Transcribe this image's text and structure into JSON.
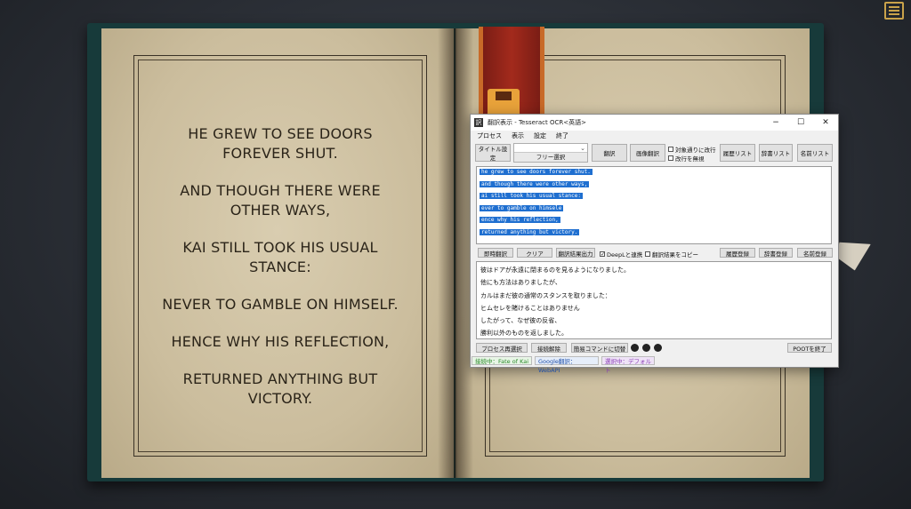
{
  "game": {
    "story_lines": [
      "HE GREW TO SEE DOORS FOREVER SHUT.",
      "AND THOUGH THERE WERE OTHER WAYS,",
      "KAI STILL TOOK HIS USUAL STANCE:",
      "NEVER TO GAMBLE ON HIMSELF.",
      "HENCE WHY HIS REFLECTION,",
      "RETURNED ANYTHING BUT VICTORY."
    ],
    "menu_icon": "menu-icon",
    "bookmark_icon": "save-icon",
    "colors": {
      "cover": "#173a3a",
      "page": "#d9cdb0",
      "ink": "#2b2419",
      "bookmark": "#a32a1c",
      "accent": "#e8a23a"
    }
  },
  "window": {
    "title": "翻訳表示 - Tesseract OCR<英語>",
    "controls": {
      "minimize": "−",
      "maximize": "☐",
      "close": "✕"
    },
    "menu": [
      "プロセス",
      "表示",
      "設定",
      "終了"
    ],
    "toolbar": {
      "title_setting": "タイトル設定",
      "free_select": "フリー選択",
      "translate": "翻訳",
      "image_translate": "画像翻訳",
      "chk_line_break": "対象通りに改行",
      "chk_ignore_break": "改行を無視",
      "history_list": "履歴リスト",
      "dict_list": "辞書リスト",
      "name_list": "名前リスト"
    },
    "ocr_lines": [
      "he grew to see doors forever shut.",
      "and though there were other ways,",
      "ai still took his usual stance:",
      "ever to gamble on himsele",
      "ence why his reflection,",
      "returned anything but victory."
    ],
    "action_bar": {
      "instant_translate": "即時翻訳",
      "clear": "クリア",
      "export": "翻訳結果出力",
      "chk_deepl": "DeepLと連携",
      "chk_deepl_checked": "✓",
      "chk_copy": "翻訳結果をコピー",
      "history_register": "履歴登録",
      "dict_register": "辞書登録",
      "name_register": "名前登録"
    },
    "translation_lines": [
      "彼はドアが永遠に閉まるのを見るようになりました。",
      "他にも方法はありましたが、",
      "カルはまだ彼の通常のスタンスを取りました：",
      "ヒムセレを賭けることはありません",
      "したがって、なぜ彼の反省、",
      "勝利以外のものを返しました。"
    ],
    "bottom_bar": {
      "process_reselect": "プロセス再選択",
      "disconnect": "接続解除",
      "simple_command": "簡易コマンドに切替",
      "exit_poot": "POOTを終了"
    },
    "status": {
      "connected": "接続中：Fate of Kai",
      "engine": "Google翻訳：WebAPI",
      "selection": "選択中：デフォルト"
    }
  }
}
